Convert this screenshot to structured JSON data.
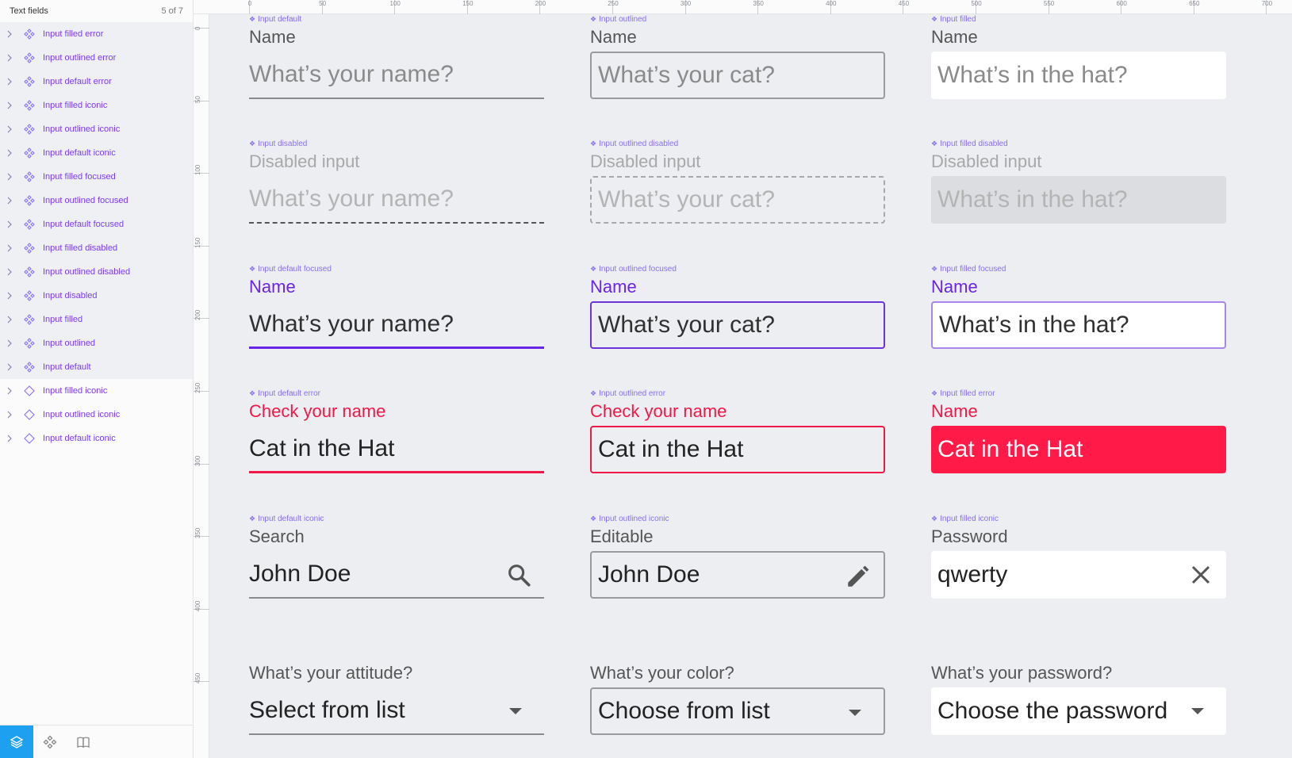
{
  "sidebar": {
    "title": "Text fields",
    "count": "5 of 7",
    "items": [
      {
        "label": "Input filled error",
        "selected": true
      },
      {
        "label": "Input outlined error",
        "selected": true
      },
      {
        "label": "Input default error",
        "selected": true
      },
      {
        "label": "Input filled iconic",
        "selected": true
      },
      {
        "label": "Input outlined iconic",
        "selected": true
      },
      {
        "label": "Input default iconic",
        "selected": true
      },
      {
        "label": "Input filled focused",
        "selected": true
      },
      {
        "label": "Input outlined focused",
        "selected": true
      },
      {
        "label": "Input default focused",
        "selected": true
      },
      {
        "label": "Input filled disabled",
        "selected": true
      },
      {
        "label": "Input outlined disabled",
        "selected": true
      },
      {
        "label": "Input disabled",
        "selected": true
      },
      {
        "label": "Input filled",
        "selected": true
      },
      {
        "label": "Input outlined",
        "selected": true
      },
      {
        "label": "Input default",
        "selected": true
      },
      {
        "label": "Input filled iconic",
        "selected": false
      },
      {
        "label": "Input outlined iconic",
        "selected": false
      },
      {
        "label": "Input default iconic",
        "selected": false
      }
    ],
    "footer_tabs": [
      "layers-icon",
      "components-icon",
      "book-icon"
    ]
  },
  "ruler": {
    "top_ticks": [
      "0",
      "50",
      "100",
      "150",
      "200",
      "250",
      "300",
      "350",
      "400",
      "450",
      "500",
      "550",
      "600",
      "650",
      "700"
    ],
    "left_ticks": [
      "0",
      "50",
      "100",
      "150",
      "200",
      "250",
      "300",
      "350",
      "400",
      "450"
    ]
  },
  "fields": {
    "r0c0": {
      "component": "Input default",
      "label": "Name",
      "value": "What’s your name?"
    },
    "r0c1": {
      "component": "Input outlined",
      "label": "Name",
      "value": "What’s your cat?"
    },
    "r0c2": {
      "component": "Input filled",
      "label": "Name",
      "value": "What’s in the hat?"
    },
    "r1c0": {
      "component": "Input disabled",
      "label": "Disabled input",
      "value": "What’s your name?"
    },
    "r1c1": {
      "component": "Input outlined disabled",
      "label": "Disabled input",
      "value": "What’s your cat?"
    },
    "r1c2": {
      "component": "Input filled disabled",
      "label": "Disabled input",
      "value": "What’s in the hat?"
    },
    "r2c0": {
      "component": "Input default focused",
      "label": "Name",
      "value": "What’s your name?"
    },
    "r2c1": {
      "component": "Input outlined focused",
      "label": "Name",
      "value": "What’s your cat?"
    },
    "r2c2": {
      "component": "Input filled focused",
      "label": "Name",
      "value": "What’s in the hat?"
    },
    "r3c0": {
      "component": "Input default error",
      "label": "Check your name",
      "value": "Cat in the Hat"
    },
    "r3c1": {
      "component": "Input outlined error",
      "label": "Check your name",
      "value": "Cat in the Hat"
    },
    "r3c2": {
      "component": "Input filled error",
      "label": "Name",
      "value": "Cat in the Hat"
    },
    "r4c0": {
      "component": "Input default iconic",
      "label": "Search",
      "value": "John Doe",
      "icon": "search-icon"
    },
    "r4c1": {
      "component": "Input outlined iconic",
      "label": "Editable",
      "value": "John Doe",
      "icon": "pencil-icon"
    },
    "r4c2": {
      "component": "Input filled iconic",
      "label": "Password",
      "value": "qwerty",
      "icon": "close-icon"
    },
    "r5c0": {
      "label": "What’s your attitude?",
      "value": "Select from list",
      "icon": "dropdown-arrow-icon"
    },
    "r5c1": {
      "label": "What’s your color?",
      "value": "Choose from list",
      "icon": "dropdown-arrow-icon"
    },
    "r5c2": {
      "label": "What’s your password?",
      "value": "Choose the password",
      "icon": "dropdown-arrow-icon"
    }
  },
  "colors": {
    "accent": "#6a24e6",
    "error": "#f01848",
    "component_label": "#8a6ff0",
    "sidebar_active": "#1ea0f0"
  }
}
